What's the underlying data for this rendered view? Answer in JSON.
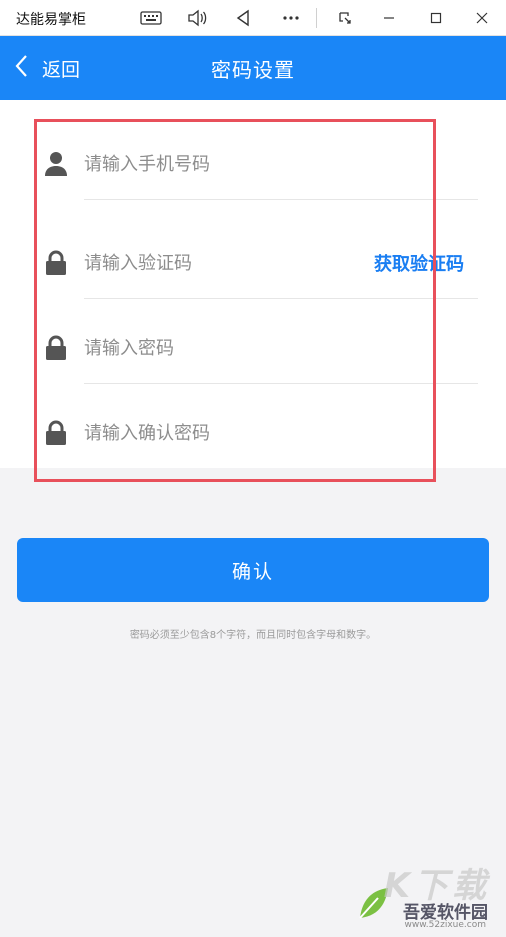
{
  "window": {
    "title": "达能易掌柜"
  },
  "header": {
    "back_label": "返回",
    "title": "密码设置"
  },
  "form": {
    "phone_placeholder": "请输入手机号码",
    "code_placeholder": "请输入验证码",
    "get_code_label": "获取验证码",
    "password_placeholder": "请输入密码",
    "confirm_password_placeholder": "请输入确认密码"
  },
  "confirm_label": "确认",
  "hint": "密码必须至少包含8个字符，而且同时包含字母和数字。",
  "watermark": {
    "big": "K下载",
    "name": "吾爱软件园",
    "url": "www.52zixue.com"
  },
  "colors": {
    "primary": "#1a86f7",
    "link": "#1a7ef2",
    "annotation_border": "#e8505b",
    "icon": "#555555"
  }
}
